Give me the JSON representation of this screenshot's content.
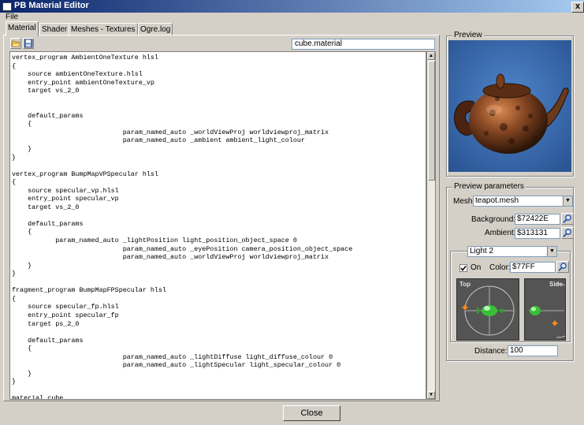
{
  "window": {
    "title": "PB Material Editor",
    "close_glyph": "x"
  },
  "menu": {
    "file": "File"
  },
  "tabs": [
    "Material",
    "Shader",
    "Meshes - Textures",
    "Ogre.log"
  ],
  "editor": {
    "filename": "cube.material",
    "code": "vertex_program AmbientOneTexture hlsl\n{\n    source ambientOneTexture.hlsl\n    entry_point ambientOneTexture_vp\n    target vs_2_0\n\n\n    default_params\n    {\n                            param_named_auto _worldViewProj worldviewproj_matrix\n                            param_named_auto _ambient ambient_light_colour\n    }\n}\n\nvertex_program BumpMapVPSpecular hlsl\n{\n    source specular_vp.hlsl\n    entry_point specular_vp\n    target vs_2_0\n\n    default_params\n    {\n           param_named_auto _lightPosition light_position_object_space 0\n                            param_named_auto _eyePosition camera_position_object_space\n                            param_named_auto _worldViewProj worldviewproj_matrix\n    }\n}\n\nfragment_program BumpMapFPSpecular hlsl\n{\n    source specular_fp.hlsl\n    entry_point specular_fp\n    target ps_2_0\n\n    default_params\n    {\n                            param_named_auto _lightDiffuse light_diffuse_colour 0\n                            param_named_auto _lightSpecular light_specular_colour 0\n    }\n}\n\nmaterial cube"
  },
  "preview": {
    "label": "Preview",
    "bg_color": "#3b6fb0"
  },
  "params": {
    "label": "Preview parameters",
    "mesh_label": "Mesh:",
    "mesh_value": "teapot.mesh",
    "background_label": "Background:",
    "background_value": "$72422E",
    "ambient_label": "Ambient:",
    "ambient_value": "$313131",
    "light_value": "Light 2",
    "on_label": "On",
    "on_checked": true,
    "color_label": "Color:",
    "color_value": "$77FF",
    "top_label": "Top",
    "side_label": "Side",
    "distance_label": "Distance:",
    "distance_value": "100"
  },
  "footer": {
    "close_label": "Close"
  }
}
